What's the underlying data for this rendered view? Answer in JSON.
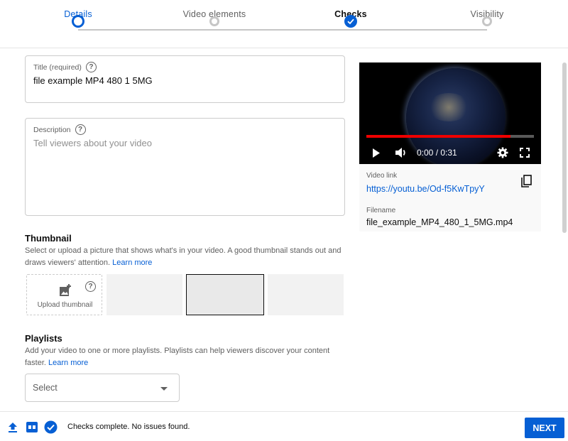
{
  "stepper": {
    "steps": [
      {
        "label": "Details",
        "state": "active"
      },
      {
        "label": "Video elements",
        "state": "todo"
      },
      {
        "label": "Checks",
        "state": "done"
      },
      {
        "label": "Visibility",
        "state": "todo"
      }
    ]
  },
  "title_field": {
    "label": "Title (required)",
    "value": "file example MP4 480 1 5MG"
  },
  "description_field": {
    "label": "Description",
    "placeholder": "Tell viewers about your video"
  },
  "thumbnail": {
    "heading": "Thumbnail",
    "description": "Select or upload a picture that shows what's in your video. A good thumbnail stands out and draws viewers' attention.",
    "learn_more": "Learn more",
    "upload_label": "Upload thumbnail"
  },
  "playlists": {
    "heading": "Playlists",
    "description": "Add your video to one or more playlists. Playlists can help viewers discover your content faster.",
    "learn_more": "Learn more",
    "select_value": "Select"
  },
  "video_card": {
    "time": "0:00 / 0:31",
    "progress": 0.86,
    "link_label": "Video link",
    "link": "https://youtu.be/Od-f5KwTpyY",
    "filename_label": "Filename",
    "filename": "file_example_MP4_480_1_5MG.mp4"
  },
  "footer": {
    "status": "Checks complete. No issues found.",
    "next_label": "NEXT"
  },
  "colors": {
    "accent": "#065fd4",
    "progress": "#ee0000"
  }
}
